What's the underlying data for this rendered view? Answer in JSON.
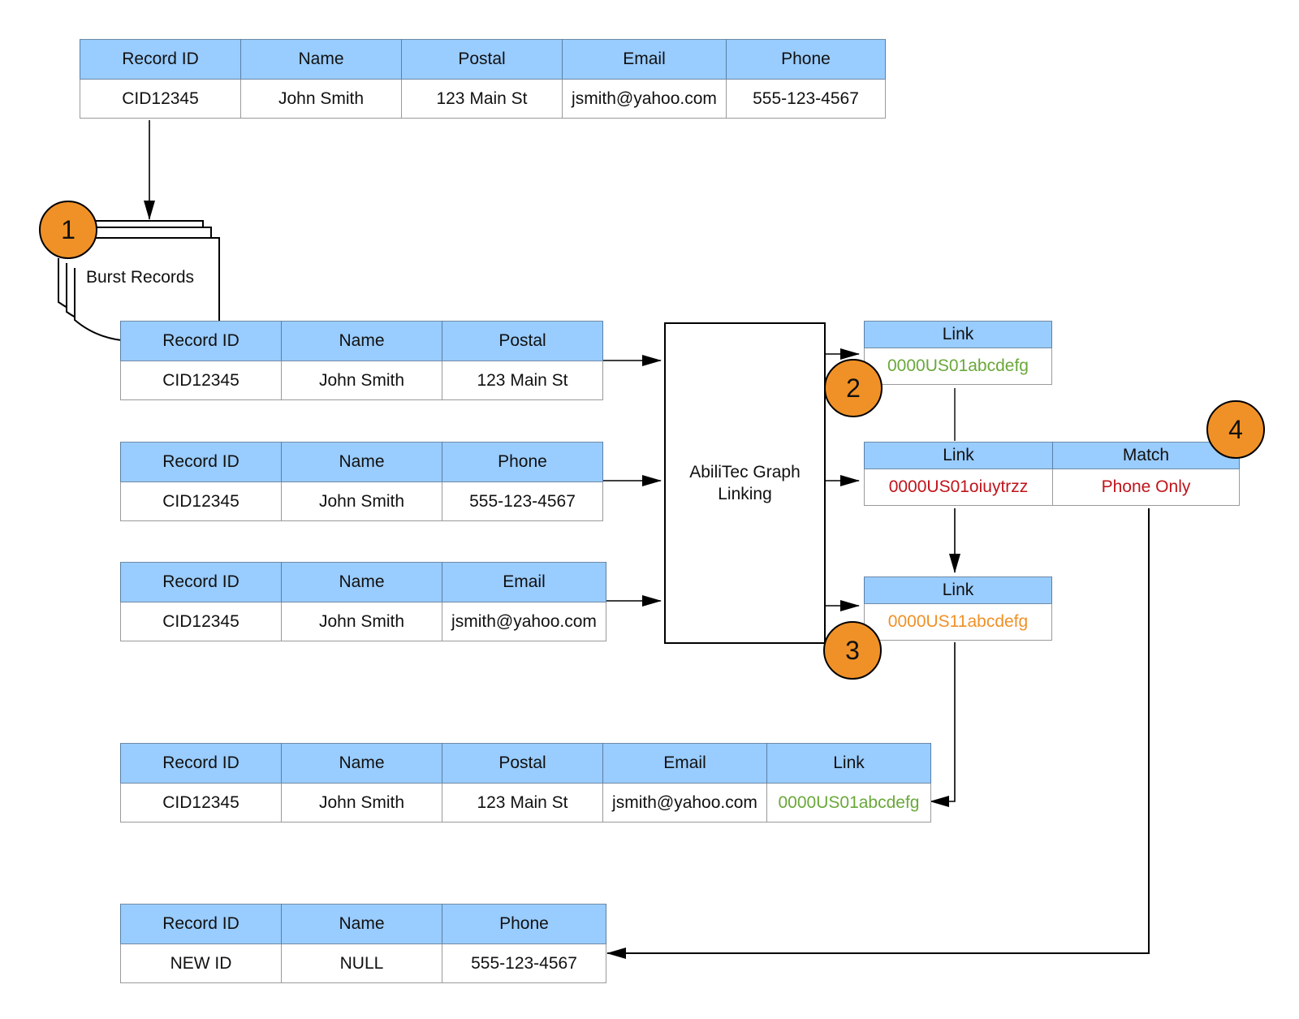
{
  "colors": {
    "header_fill": "#99ccff",
    "badge_fill": "#f09127",
    "link_match": "#6aa83a",
    "link_mismatch": "#c0141b",
    "link_new": "#f09127"
  },
  "source_record": {
    "headers": [
      "Record ID",
      "Name",
      "Postal",
      "Email",
      "Phone"
    ],
    "row": [
      "CID12345",
      "John Smith",
      "123 Main St",
      "jsmith@yahoo.com",
      "555-123-4567"
    ]
  },
  "burst": {
    "label": "Burst Records",
    "badge": "1"
  },
  "burst_records": [
    {
      "headers": [
        "Record ID",
        "Name",
        "Postal"
      ],
      "row": [
        "CID12345",
        "John Smith",
        "123 Main St"
      ]
    },
    {
      "headers": [
        "Record ID",
        "Name",
        "Phone"
      ],
      "row": [
        "CID12345",
        "John Smith",
        "555-123-4567"
      ]
    },
    {
      "headers": [
        "Record ID",
        "Name",
        "Email"
      ],
      "row": [
        "CID12345",
        "John Smith",
        "jsmith@yahoo.com"
      ]
    }
  ],
  "process": {
    "label_line1": "AbiliTec Graph",
    "label_line2": "Linking"
  },
  "link_results": [
    {
      "header": "Link",
      "value": "0000US01abcdefg",
      "status": "match",
      "badge": "2"
    },
    {
      "header": "Link",
      "value": "0000US01oiuytrzz",
      "status": "mismatch",
      "match_header": "Match",
      "match_value": "Phone Only",
      "badge": "4"
    },
    {
      "header": "Link",
      "value": "0000US11abcdefg",
      "status": "new",
      "badge": "3"
    }
  ],
  "final_record": {
    "headers": [
      "Record ID",
      "Name",
      "Postal",
      "Email",
      "Link"
    ],
    "row": [
      "CID12345",
      "John Smith",
      "123 Main St",
      "jsmith@yahoo.com",
      "0000US01abcdefg"
    ]
  },
  "new_record": {
    "headers": [
      "Record ID",
      "Name",
      "Phone"
    ],
    "row": [
      "NEW ID",
      "NULL",
      "555-123-4567"
    ]
  }
}
